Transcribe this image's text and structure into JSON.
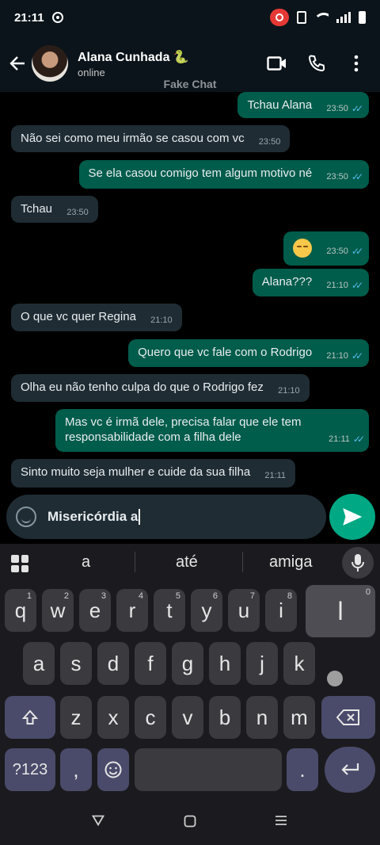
{
  "statusbar": {
    "time": "21:11"
  },
  "header": {
    "contact_name": "Alana Cunhada 🐍",
    "contact_status": "online",
    "watermark": "Fake Chat"
  },
  "messages": [
    {
      "dir": "out",
      "text": "Tchau Alana",
      "time": "23:50",
      "read": true
    },
    {
      "dir": "in",
      "text": "Não sei como meu irmão se casou com vc",
      "time": "23:50"
    },
    {
      "dir": "out",
      "text": "Se ela casou comigo tem algum motivo né",
      "time": "23:50",
      "read": true
    },
    {
      "dir": "in",
      "text": "Tchau",
      "time": "23:50"
    },
    {
      "dir": "out",
      "text": "😩",
      "time": "23:50",
      "read": true
    },
    {
      "dir": "out",
      "text": "Alana???",
      "time": "21:10",
      "read": true
    },
    {
      "dir": "in",
      "text": "O que vc quer Regina",
      "time": "21:10"
    },
    {
      "dir": "out",
      "text": "Quero que vc fale com o Rodrigo",
      "time": "21:10",
      "read": true
    },
    {
      "dir": "in",
      "text": "Olha eu não tenho culpa do que o Rodrigo fez",
      "time": "21:10"
    },
    {
      "dir": "out",
      "text": "Mas vc é irmã dele, precisa falar que ele tem responsabilidade com a filha dele",
      "time": "21:11",
      "read": true
    },
    {
      "dir": "in",
      "text": "Sinto muito seja mulher e cuide da sua filha",
      "time": "21:11"
    }
  ],
  "composer": {
    "value": "Misericórdia a"
  },
  "keyboard": {
    "suggestions": [
      "a",
      "até",
      "amiga"
    ],
    "row1": [
      {
        "k": "q",
        "n": "1"
      },
      {
        "k": "w",
        "n": "2"
      },
      {
        "k": "e",
        "n": "3"
      },
      {
        "k": "r",
        "n": "4"
      },
      {
        "k": "t",
        "n": "5"
      },
      {
        "k": "y",
        "n": "6"
      },
      {
        "k": "u",
        "n": "7"
      },
      {
        "k": "i",
        "n": "8"
      },
      {
        "k": "l",
        "n": ""
      },
      {
        "k": "",
        "n": "0"
      }
    ],
    "row2": [
      "a",
      "s",
      "d",
      "f",
      "g",
      "h",
      "j",
      "k"
    ],
    "row3": [
      "z",
      "x",
      "c",
      "v",
      "b",
      "n",
      "m"
    ],
    "symbols_label": "?123",
    "comma": ",",
    "period": "."
  },
  "colors": {
    "incoming": "#1f2c34",
    "outgoing": "#005c4b",
    "accent": "#00a884",
    "read_ticks": "#53bdeb"
  }
}
